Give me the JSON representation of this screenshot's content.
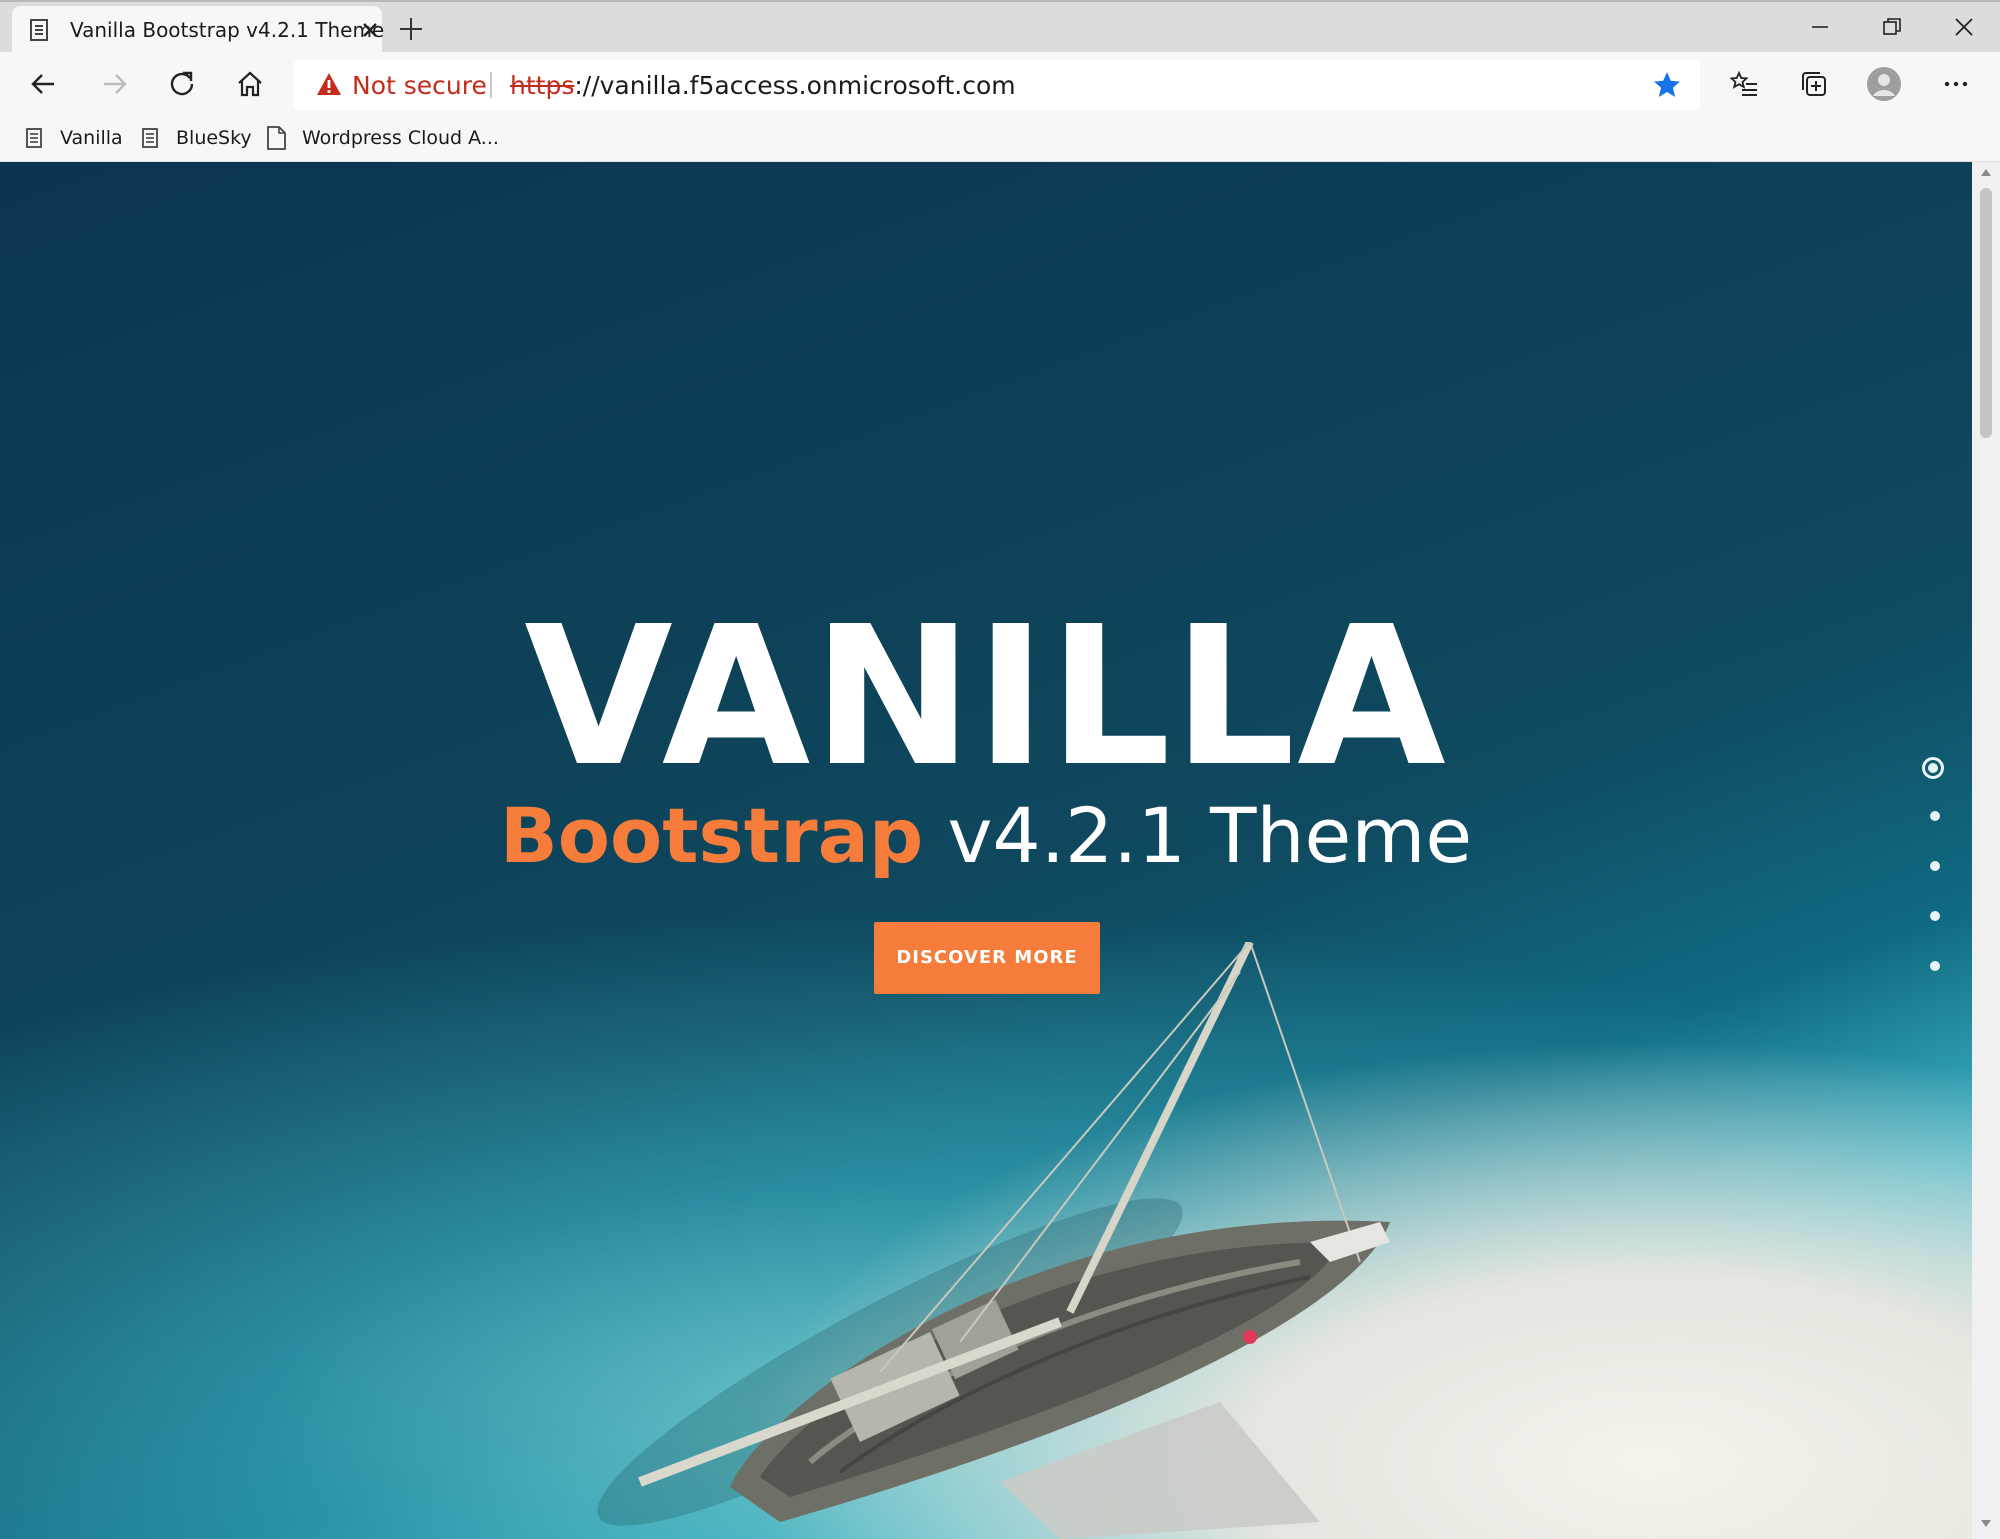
{
  "browser": {
    "tab": {
      "title": "Vanilla Bootstrap v4.2.1 Theme",
      "icon": "page-icon"
    },
    "address": {
      "security_label": "Not secure",
      "url_scheme": "https",
      "url_rest": "://vanilla.f5access.onmicrosoft.com"
    },
    "bookmarks": [
      {
        "label": "Vanilla",
        "icon": "page-icon"
      },
      {
        "label": "BlueSky",
        "icon": "page-icon"
      },
      {
        "label": "Wordpress Cloud A...",
        "icon": "document-icon"
      }
    ]
  },
  "hero": {
    "title": "VANILLA",
    "subtitle_accent": "Bootstrap",
    "subtitle_rest": " v4.2.1 Theme",
    "button_label": "DISCOVER MORE",
    "slide_count": 5,
    "active_slide": 1
  },
  "colors": {
    "accent": "#f57c3a",
    "warning": "#c42b1c",
    "star": "#1a73e8"
  }
}
